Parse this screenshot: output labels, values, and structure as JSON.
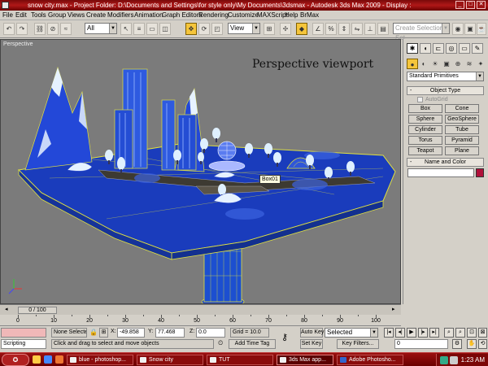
{
  "window": {
    "title": "snow city.max     - Project Folder: D:\\Documents and Settings\\for style only\\My Documents\\3dsmax     - Autodesk 3ds Max  2009        - Display :"
  },
  "menu": [
    "File",
    "Edit",
    "Tools",
    "Group",
    "Views",
    "Create",
    "Modifiers",
    "Animation",
    "Graph Editors",
    "Rendering",
    "Customize",
    "MAXScript",
    "Help",
    "BrMax"
  ],
  "toolbar": {
    "selection_filter": "All",
    "reference_coord": "View",
    "named_selection_placeholder": "Create Selection Set",
    "icons": [
      "undo-icon",
      "redo-icon",
      "select-link-icon",
      "unlink-icon",
      "bind-spacewarp-icon",
      "select-object-icon",
      "select-by-name-icon",
      "rectangular-selection-icon",
      "window-crossing-icon",
      "select-and-move-icon",
      "select-and-rotate-icon",
      "select-and-scale-icon",
      "pivot-icon",
      "select-manipulate-icon",
      "snap-toggle-icon",
      "angle-snap-icon",
      "percent-snap-icon",
      "spinner-snap-icon",
      "mirror-icon",
      "align-icon",
      "layer-manager-icon",
      "curve-editor-icon",
      "material-editor-icon",
      "render-setup-icon",
      "render-icon"
    ]
  },
  "viewport": {
    "label": "Perspective",
    "annotation": "Perspective viewport",
    "tooltip": "Box01",
    "colors": {
      "background": "#7b7b7b",
      "platform": "#1c43c8",
      "edge": "#e0e040",
      "tree": "#dff0ff"
    }
  },
  "command_panel": {
    "tabs": [
      "create-tab",
      "modify-tab",
      "hierarchy-tab",
      "motion-tab",
      "display-tab",
      "utilities-tab"
    ],
    "subtabs": [
      "geometry-icon",
      "shapes-icon",
      "lights-icon",
      "cameras-icon",
      "helpers-icon",
      "spacewarps-icon",
      "systems-icon"
    ],
    "category": "Standard Primitives",
    "object_type": {
      "header": "Object Type",
      "autogrid": "AutoGrid",
      "buttons": [
        "Box",
        "Cone",
        "Sphere",
        "GeoSphere",
        "Cylinder",
        "Tube",
        "Torus",
        "Pyramid",
        "Teapot",
        "Plane"
      ]
    },
    "name_and_color": {
      "header": "Name and Color",
      "object_color": "#b0103a"
    }
  },
  "timeline": {
    "frame_display": "0 / 100",
    "ticks": [
      "0",
      "10",
      "20",
      "30",
      "40",
      "50",
      "60",
      "70",
      "80",
      "90",
      "100"
    ]
  },
  "status": {
    "scripting_label": "Scripting",
    "selection": "None Selecte",
    "x_label": "X:",
    "x_value": "-49.858",
    "y_label": "Y:",
    "y_value": "77.468",
    "z_label": "Z:",
    "z_value": "0.0",
    "grid": "Grid = 10.0",
    "prompt": "Click and drag to select and move objects",
    "add_time_tag": "Add Time Tag",
    "auto_key": "Auto Key",
    "set_key": "Set Key",
    "key_mode": "Selected",
    "key_filters": "Key Filters...",
    "current_frame": "0"
  },
  "taskbar": {
    "tasks": [
      "blue - photoshop...",
      "Snow city",
      "TUT",
      "3ds Max app...",
      "Adobe Photosho..."
    ],
    "clock": "1:23 AM"
  }
}
